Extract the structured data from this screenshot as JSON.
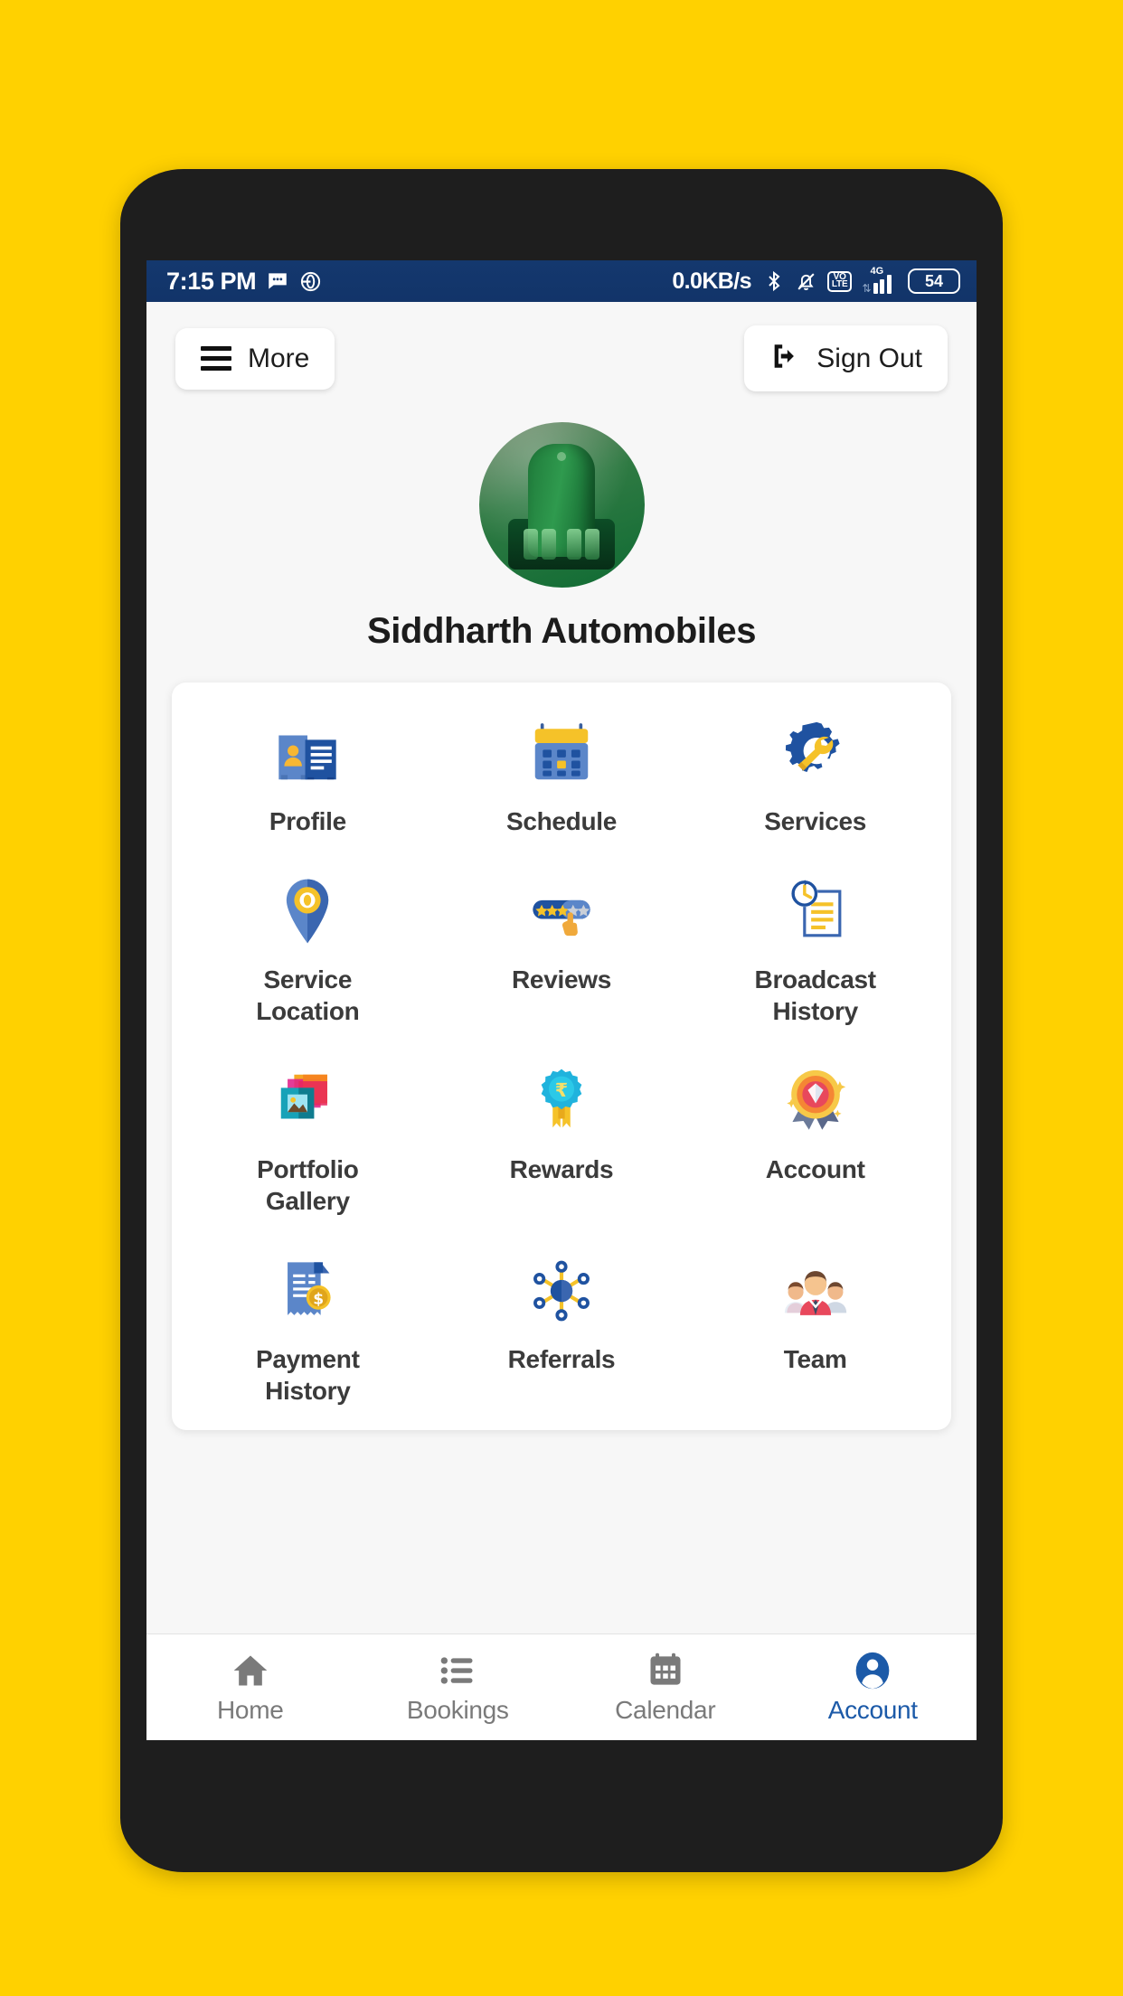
{
  "statusbar": {
    "time": "7:15 PM",
    "network_speed": "0.0KB/s",
    "battery_level": "54",
    "volte_top": "VO",
    "volte_bottom": "LTE",
    "network_type": "4G",
    "icons": [
      "sms-icon",
      "opera-icon",
      "bluetooth-icon",
      "notifications-muted-icon",
      "volte-icon",
      "signal-icon",
      "battery-icon"
    ],
    "background_color": "#153a70"
  },
  "header": {
    "more_label": "More",
    "sign_out_label": "Sign Out"
  },
  "profile": {
    "business_name": "Siddharth Automobiles",
    "avatar_alt": "business-avatar"
  },
  "menu": {
    "items": [
      {
        "label": "Profile",
        "icon": "id-card-icon"
      },
      {
        "label": "Schedule",
        "icon": "calendar-icon"
      },
      {
        "label": "Services",
        "icon": "gear-wrench-icon"
      },
      {
        "label": "Service\nLocation",
        "icon": "map-pin-icon"
      },
      {
        "label": "Reviews",
        "icon": "star-rating-icon"
      },
      {
        "label": "Broadcast\nHistory",
        "icon": "clock-document-icon"
      },
      {
        "label": "Portfolio\nGallery",
        "icon": "photos-icon"
      },
      {
        "label": "Rewards",
        "icon": "rupee-badge-icon"
      },
      {
        "label": "Account",
        "icon": "diamond-medal-icon"
      },
      {
        "label": "Payment\nHistory",
        "icon": "invoice-dollar-icon"
      },
      {
        "label": "Referrals",
        "icon": "network-nodes-icon"
      },
      {
        "label": "Team",
        "icon": "people-group-icon"
      }
    ]
  },
  "bottom_nav": {
    "items": [
      {
        "label": "Home",
        "icon": "home-icon",
        "active": false
      },
      {
        "label": "Bookings",
        "icon": "list-icon",
        "active": false
      },
      {
        "label": "Calendar",
        "icon": "calendar-icon",
        "active": false
      },
      {
        "label": "Account",
        "icon": "person-icon",
        "active": true
      }
    ],
    "active_color": "#1c5aa8",
    "inactive_color": "#7a7a7a"
  },
  "theme": {
    "page_background": "#FFD100",
    "phone_frame": "#1e1e1e",
    "screen_background": "#f7f7f7",
    "card_background": "#ffffff"
  }
}
